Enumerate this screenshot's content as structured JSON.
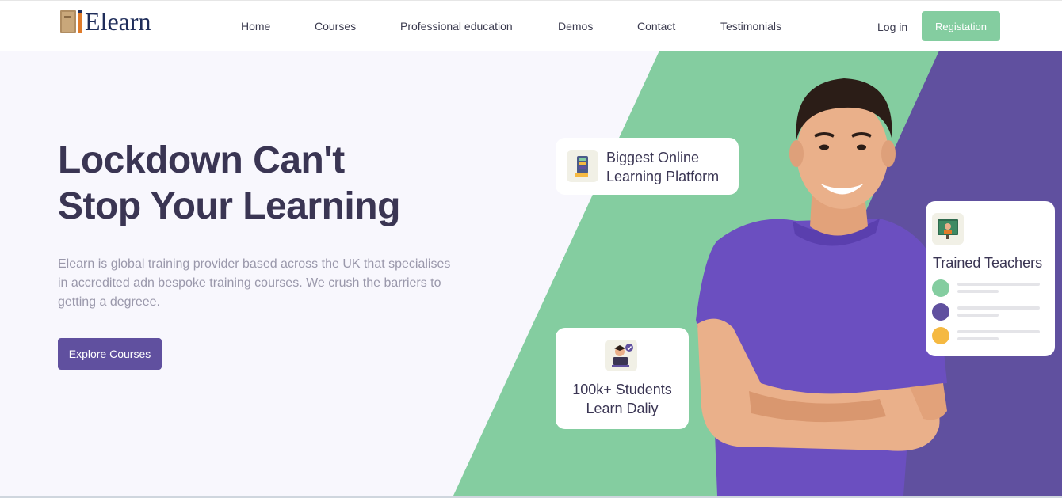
{
  "brand": {
    "name": "Elearn"
  },
  "nav": {
    "items": [
      {
        "label": "Home"
      },
      {
        "label": "Courses"
      },
      {
        "label": "Professional education"
      },
      {
        "label": "Demos"
      },
      {
        "label": "Contact"
      },
      {
        "label": "Testimonials"
      }
    ],
    "login_label": "Log in",
    "register_label": "Registation"
  },
  "hero": {
    "headline_line1": "Lockdown Can't",
    "headline_line2": "Stop Your Learning",
    "description": "Elearn is global training provider based across the UK that specialises in accredited adn bespoke training courses. We crush the barriers to getting a degreee.",
    "cta_label": "Explore Courses"
  },
  "cards": {
    "platform": {
      "line1": "Biggest Online",
      "line2": "Learning Platform",
      "icon": "tablet-books-icon"
    },
    "students": {
      "line1": "100k+ Students",
      "line2": "Learn Daliy",
      "icon": "student-laptop-icon"
    },
    "teachers": {
      "title": "Trained Teachers",
      "icon": "chalkboard-teacher-icon",
      "dot_colors": [
        "#84cda0",
        "#60509f",
        "#f5b942"
      ]
    }
  },
  "colors": {
    "accent_green": "#84cda0",
    "accent_purple": "#60509f",
    "heading": "#3a3553",
    "background": "#f8f7fd"
  }
}
